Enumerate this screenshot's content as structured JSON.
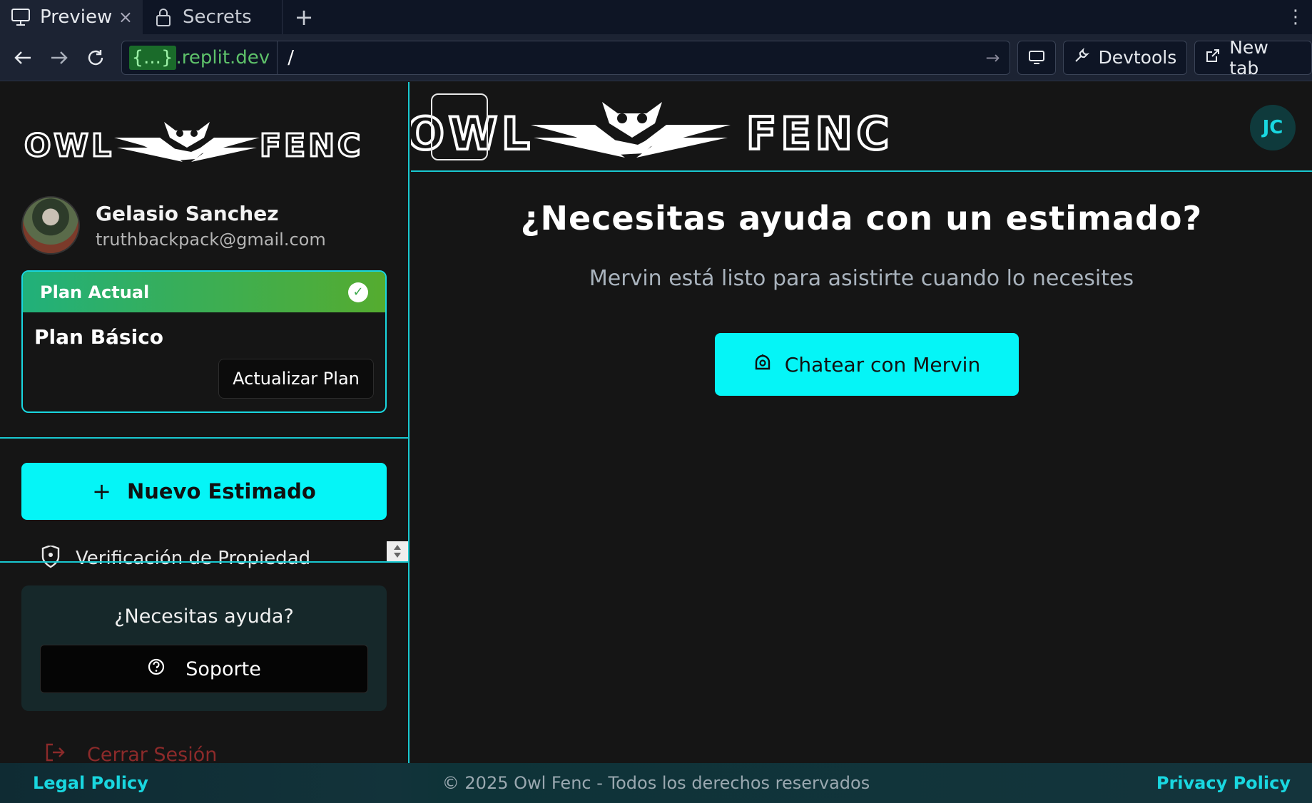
{
  "browser": {
    "tabs": [
      {
        "label": "Preview",
        "icon": "monitor-icon"
      },
      {
        "label": "Secrets",
        "icon": "lock-icon"
      }
    ],
    "url_host": "{...}.replit.dev",
    "url_host_brace": "{...}",
    "url_host_domain": ".replit.dev",
    "url_path": "/",
    "devtools_label": "Devtools",
    "newtab_label": "New tab"
  },
  "sidebar": {
    "logo_text_left": "OWL",
    "logo_text_right": "FENC",
    "user": {
      "name": "Gelasio Sanchez",
      "email": "truthbackpack@gmail.com"
    },
    "plan": {
      "header": "Plan Actual",
      "name": "Plan Básico",
      "upgrade_label": "Actualizar Plan"
    },
    "new_estimate_label": "Nuevo Estimado",
    "menu_item_label": "Verificación de Propiedad",
    "help": {
      "title": "¿Necesitas ayuda?",
      "support_label": "Soporte"
    },
    "logout_label": "Cerrar Sesión"
  },
  "main": {
    "logo_text_left": "OWL",
    "logo_text_right": "FENC",
    "avatar_initials": "JC",
    "headline": "¿Necesitas ayuda con un estimado?",
    "subline": "Mervin está listo para asistirte cuando lo necesites",
    "chat_label": "Chatear con Mervin"
  },
  "footer": {
    "legal": "Legal Policy",
    "copyright": "© 2025 Owl Fenc - Todos los derechos reservados",
    "privacy": "Privacy Policy"
  },
  "colors": {
    "accent": "#05f5f7",
    "border": "#19c9d1",
    "plan_green": "#3aa84a",
    "background": "#151515"
  }
}
